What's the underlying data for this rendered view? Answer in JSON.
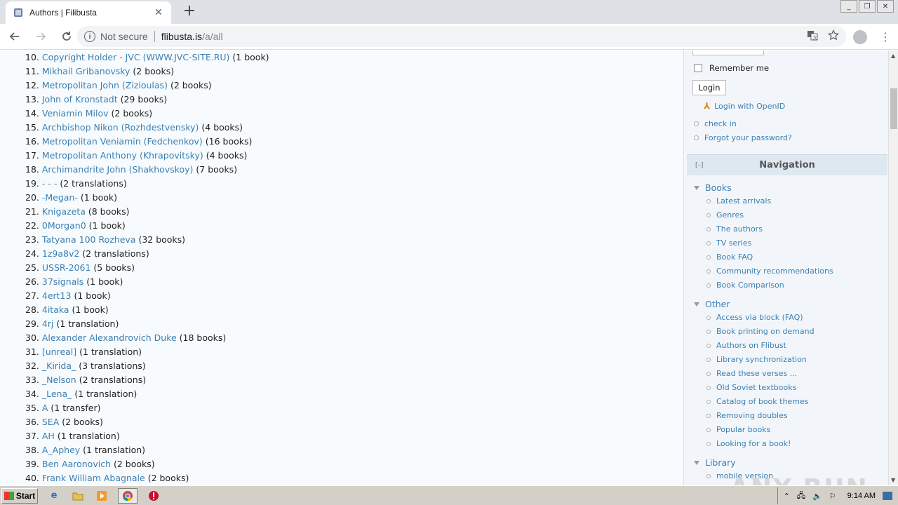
{
  "browser": {
    "tab_title": "Authors | Filibusta",
    "tab_close": "✕",
    "new_tab": "+",
    "address_secure": "Not secure",
    "address_host": "flibusta.is",
    "address_path": "/a/all"
  },
  "authors": [
    {
      "num": "10.",
      "name": "Copyright Holder - JVC (WWW.JVC-SITE.RU)",
      "count": "(1 book)"
    },
    {
      "num": "11.",
      "name": "Mikhail Gribanovsky",
      "count": "(2 books)"
    },
    {
      "num": "12.",
      "name": "Metropolitan John (Zizioulas)",
      "count": "(2 books)"
    },
    {
      "num": "13.",
      "name": "John of Kronstadt",
      "count": "(29 books)"
    },
    {
      "num": "14.",
      "name": "Veniamin Milov",
      "count": "(2 books)"
    },
    {
      "num": "15.",
      "name": "Archbishop Nikon (Rozhdestvensky)",
      "count": "(4 books)"
    },
    {
      "num": "16.",
      "name": "Metropolitan Veniamin (Fedchenkov)",
      "count": "(16 books)"
    },
    {
      "num": "17.",
      "name": "Metropolitan Anthony (Khrapovitsky)",
      "count": "(4 books)"
    },
    {
      "num": "18.",
      "name": "Archimandrite John (Shakhovskoy)",
      "count": "(7 books)"
    },
    {
      "num": "19.",
      "name": "- - -",
      "count": "(2 translations)"
    },
    {
      "num": "20.",
      "name": "-Megan-",
      "count": "(1 book)"
    },
    {
      "num": "21.",
      "name": "Knigazeta",
      "count": "(8 books)"
    },
    {
      "num": "22.",
      "name": "0Morgan0",
      "count": "(1 book)"
    },
    {
      "num": "23.",
      "name": "Tatyana 100 Rozheva",
      "count": "(32 books)"
    },
    {
      "num": "24.",
      "name": "1z9a8v2",
      "count": "(2 translations)"
    },
    {
      "num": "25.",
      "name": "USSR-2061",
      "count": "(5 books)"
    },
    {
      "num": "26.",
      "name": "37signals",
      "count": "(1 book)"
    },
    {
      "num": "27.",
      "name": "4ert13",
      "count": "(1 book)"
    },
    {
      "num": "28.",
      "name": "4itaka",
      "count": "(1 book)"
    },
    {
      "num": "29.",
      "name": "4rj",
      "count": "(1 translation)"
    },
    {
      "num": "30.",
      "name": "Alexander Alexandrovich Duke",
      "count": "(18 books)"
    },
    {
      "num": "31.",
      "name": "[unreal]",
      "count": "(1 translation)"
    },
    {
      "num": "32.",
      "name": "_Kirida_",
      "count": "(3 translations)"
    },
    {
      "num": "33.",
      "name": "_Nelson",
      "count": "(2 translations)"
    },
    {
      "num": "34.",
      "name": "_Lena_",
      "count": "(1 translation)"
    },
    {
      "num": "35.",
      "name": "A",
      "count": "(1 transfer)"
    },
    {
      "num": "36.",
      "name": "SEA",
      "count": "(2 books)"
    },
    {
      "num": "37.",
      "name": "AH",
      "count": "(1 translation)"
    },
    {
      "num": "38.",
      "name": "A_Aphey",
      "count": "(1 translation)"
    },
    {
      "num": "39.",
      "name": "Ben Aaronovich",
      "count": "(2 books)"
    },
    {
      "num": "40.",
      "name": "Frank William Abagnale",
      "count": "(2 books)"
    }
  ],
  "sidebar": {
    "remember_me": "Remember me",
    "login_button": "Login",
    "login_openid": "Login with OpenID",
    "check_in": "check in",
    "forgot_password": "Forgot your password?",
    "nav_collapse": "[–]",
    "nav_title": "Navigation",
    "books_section": "Books",
    "books_items": [
      "Latest arrivals",
      "Genres",
      "The authors",
      "TV series",
      "Book FAQ",
      "Community recommendations",
      "Book Comparison"
    ],
    "other_section": "Other",
    "other_items": [
      "Access via block (FAQ)",
      "Book printing on demand",
      "Authors on Flibust",
      "Library synchronization",
      "Read these verses ...",
      "Old Soviet textbooks",
      "Catalog of book themes",
      "Removing doubles",
      "Popular books",
      "Looking for a book!"
    ],
    "library_section": "Library",
    "library_items": [
      "mobile version"
    ]
  },
  "watermark": "ANY RUN",
  "taskbar": {
    "start": "Start",
    "clock": "9:14 AM"
  }
}
